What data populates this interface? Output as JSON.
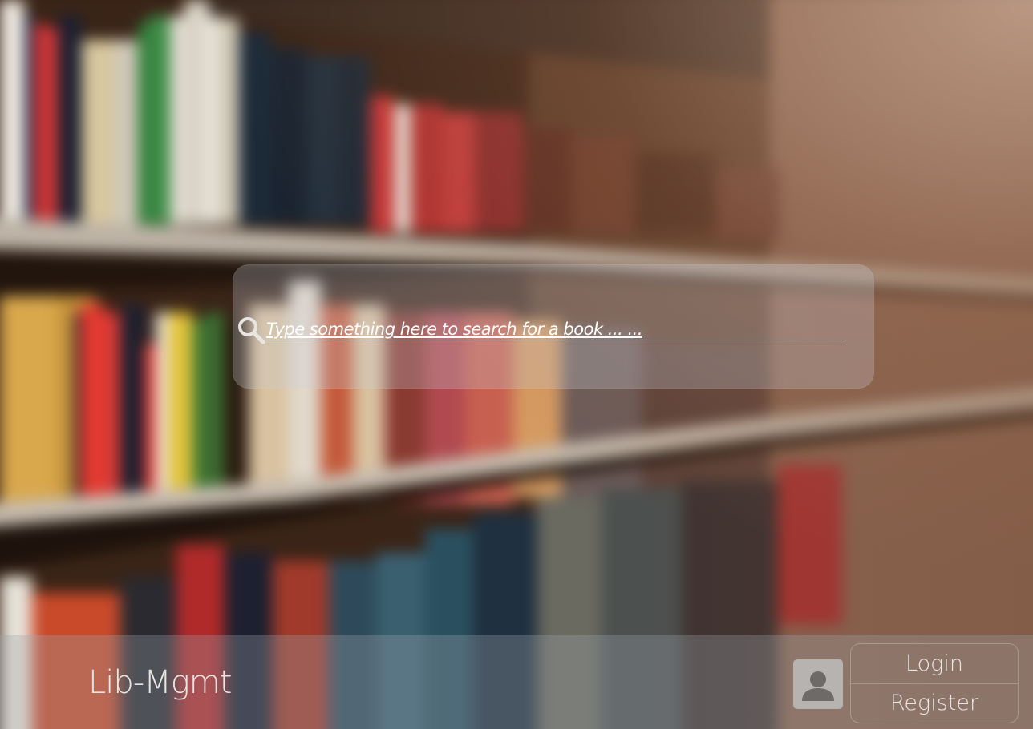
{
  "search": {
    "placeholder": "Type something here to search for a book ... ..."
  },
  "footer": {
    "brand": "Lib-Mgmt",
    "login_label": "Login",
    "register_label": "Register"
  },
  "icons": {
    "search": "search-icon",
    "avatar": "user-avatar-icon"
  },
  "colors": {
    "panel_tint": "#c8cdd7",
    "text": "#ffffff",
    "brand_text": "#e9e6e2",
    "avatar_bg": "#b7b3b0"
  }
}
